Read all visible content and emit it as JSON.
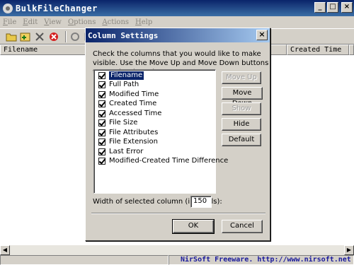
{
  "main_window": {
    "title": "BulkFileChanger",
    "menu": [
      "File",
      "Edit",
      "View",
      "Options",
      "Actions",
      "Help"
    ],
    "columns": [
      "Filename",
      "Created Time"
    ],
    "status_credit": "NirSoft Freeware.  http://www.nirsoft.net"
  },
  "toolbar": {
    "icons": [
      "open-folder-icon",
      "add-files-icon",
      "remove-icon",
      "stop-icon",
      "refresh-icon",
      "properties-icon"
    ]
  },
  "dialog": {
    "title": "Column Settings",
    "close_label": "×",
    "instructions": "Check the columns that you would like to make visible. Use the Move Up and Move Down buttons to reorder the columns",
    "columns": [
      {
        "label": "Filename",
        "checked": true,
        "selected": true
      },
      {
        "label": "Full Path",
        "checked": true
      },
      {
        "label": "Modified Time",
        "checked": true
      },
      {
        "label": "Created Time",
        "checked": true
      },
      {
        "label": "Accessed Time",
        "checked": true
      },
      {
        "label": "File Size",
        "checked": true
      },
      {
        "label": "File Attributes",
        "checked": true
      },
      {
        "label": "File Extension",
        "checked": true
      },
      {
        "label": "Last Error",
        "checked": true
      },
      {
        "label": "Modified-Created Time Difference",
        "checked": true
      }
    ],
    "buttons": {
      "move_up": "Move Up",
      "move_down": "Move Down",
      "show": "Show",
      "hide": "Hide",
      "default": "Default",
      "ok": "OK",
      "cancel": "Cancel"
    },
    "width_label": "Width of selected column (in pixels):",
    "width_value": "150"
  }
}
